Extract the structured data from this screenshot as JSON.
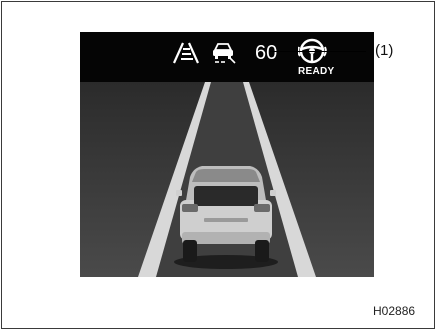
{
  "display": {
    "set_speed": "60",
    "status_text": "READY",
    "icons": [
      "lane-keep-icon",
      "vehicle-distance-icon",
      "steering-wheel-icon"
    ]
  },
  "callout": {
    "label": "(1)"
  },
  "figure_code": "H02886",
  "colors": {
    "screen_bg": "#3a3a3a",
    "topbar_bg": "#050505",
    "lane_line": "#d8d8d8",
    "vehicle_body": "#c9c9c9"
  }
}
